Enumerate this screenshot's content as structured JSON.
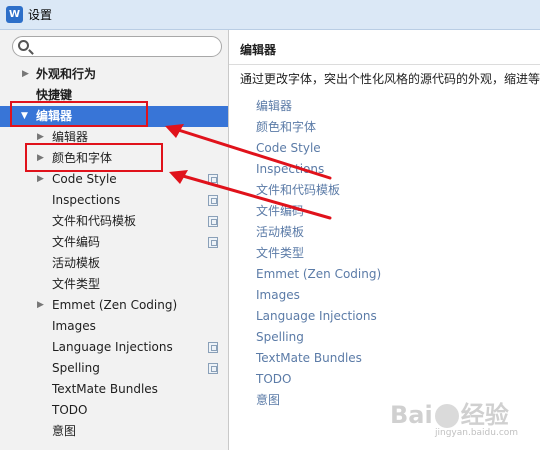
{
  "window": {
    "title": "设置",
    "app_icon_letter": "W"
  },
  "search": {
    "value": "",
    "placeholder": ""
  },
  "tree": {
    "appearance": "外观和行为",
    "keymap": "快捷键",
    "editor": "编辑器",
    "editor_general": "编辑器",
    "colors_fonts": "颜色和字体",
    "code_style": "Code Style",
    "inspections": "Inspections",
    "file_templates": "文件和代码模板",
    "file_encodings": "文件编码",
    "live_templates": "活动模板",
    "file_types": "文件类型",
    "emmet": "Emmet (Zen Coding)",
    "images": "Images",
    "language_injections": "Language Injections",
    "spelling": "Spelling",
    "textmate": "TextMate Bundles",
    "todo": "TODO",
    "intentions": "意图"
  },
  "right": {
    "title": "编辑器",
    "description": "通过更改字体，突出个性化风格的源代码的外观，缩进等",
    "links": [
      "编辑器",
      "颜色和字体",
      "Code Style",
      "Inspections",
      "文件和代码模板",
      "文件编码",
      "活动模板",
      "文件类型",
      "Emmet (Zen Coding)",
      "Images",
      "Language Injections",
      "Spelling",
      "TextMate Bundles",
      "TODO",
      "意图"
    ]
  },
  "watermark": {
    "text": "Bai",
    "text2": "经验",
    "sub": "jingyan.baidu.com"
  },
  "colors": {
    "selection": "#3875d7",
    "link": "#5b7ba7",
    "callout": "#e0121b"
  },
  "icons": [
    "search-icon",
    "expand-arrow-icon",
    "collapse-arrow-icon",
    "project-scope-icon"
  ]
}
